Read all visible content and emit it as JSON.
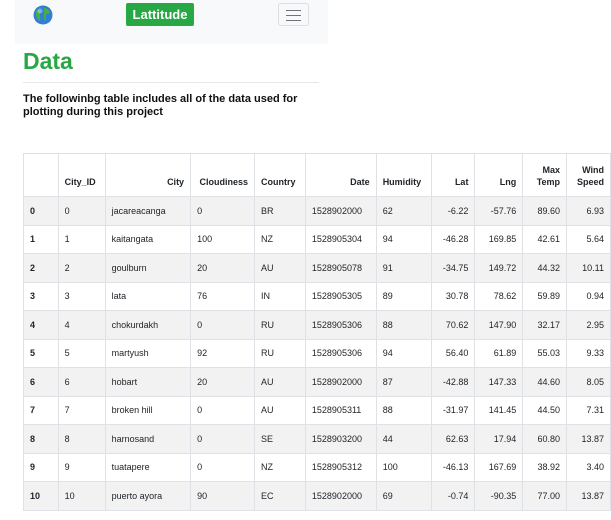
{
  "navbar": {
    "brand": "Lattitude",
    "globe_icon": "globe-icon",
    "toggler_icon": "hamburger-menu-icon",
    "brand_color": "#28a745"
  },
  "page": {
    "title": "Data",
    "description": "The followinbg table includes all of the data used for plotting during this project"
  },
  "table": {
    "headers": [
      "",
      "City_ID",
      "City",
      "Cloudiness",
      "Country",
      "Date",
      "Humidity",
      "Lat",
      "Lng",
      "Max Temp",
      "Wind Speed"
    ],
    "rows": [
      [
        "0",
        "0",
        "jacareacanga",
        "0",
        "BR",
        "1528902000",
        "62",
        "-6.22",
        "-57.76",
        "89.60",
        "6.93"
      ],
      [
        "1",
        "1",
        "kaitangata",
        "100",
        "NZ",
        "1528905304",
        "94",
        "-46.28",
        "169.85",
        "42.61",
        "5.64"
      ],
      [
        "2",
        "2",
        "goulburn",
        "20",
        "AU",
        "1528905078",
        "91",
        "-34.75",
        "149.72",
        "44.32",
        "10.11"
      ],
      [
        "3",
        "3",
        "lata",
        "76",
        "IN",
        "1528905305",
        "89",
        "30.78",
        "78.62",
        "59.89",
        "0.94"
      ],
      [
        "4",
        "4",
        "chokurdakh",
        "0",
        "RU",
        "1528905306",
        "88",
        "70.62",
        "147.90",
        "32.17",
        "2.95"
      ],
      [
        "5",
        "5",
        "martyush",
        "92",
        "RU",
        "1528905306",
        "94",
        "56.40",
        "61.89",
        "55.03",
        "9.33"
      ],
      [
        "6",
        "6",
        "hobart",
        "20",
        "AU",
        "1528902000",
        "87",
        "-42.88",
        "147.33",
        "44.60",
        "8.05"
      ],
      [
        "7",
        "7",
        "broken hill",
        "0",
        "AU",
        "1528905311",
        "88",
        "-31.97",
        "141.45",
        "44.50",
        "7.31"
      ],
      [
        "8",
        "8",
        "harnosand",
        "0",
        "SE",
        "1528903200",
        "44",
        "62.63",
        "17.94",
        "60.80",
        "13.87"
      ],
      [
        "9",
        "9",
        "tuatapere",
        "0",
        "NZ",
        "1528905312",
        "100",
        "-46.13",
        "167.69",
        "38.92",
        "3.40"
      ],
      [
        "10",
        "10",
        "puerto ayora",
        "90",
        "EC",
        "1528902000",
        "69",
        "-0.74",
        "-90.35",
        "77.00",
        "13.87"
      ]
    ]
  }
}
